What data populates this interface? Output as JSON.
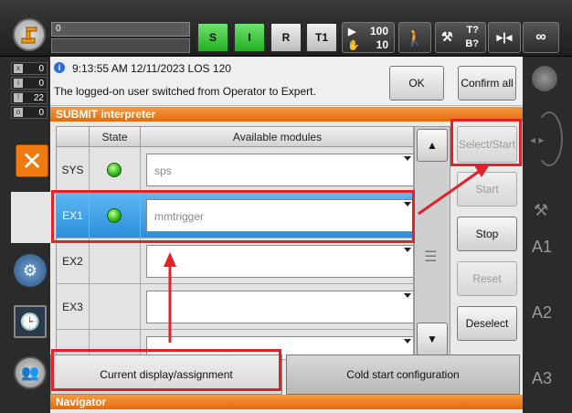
{
  "topbar": {
    "program_value": "0",
    "status_s": "S",
    "status_i": "I",
    "status_r": "R",
    "mode": "T1",
    "speed_top": "100",
    "speed_bottom": "10",
    "tool_top": "T?",
    "tool_bottom": "B?",
    "infinity": "∞"
  },
  "left_counters": [
    {
      "icon": "x",
      "value": "0"
    },
    {
      "icon": "i",
      "value": "0"
    },
    {
      "icon": "!",
      "value": "22"
    },
    {
      "icon": "o",
      "value": "0"
    }
  ],
  "message": {
    "info_icon": "i",
    "timestamp": "9:13:55 AM 12/11/2023 LOS 120",
    "text": "The logged-on user switched from Operator to Expert.",
    "ok_label": "OK",
    "confirm_all_label": "Confirm all"
  },
  "submit": {
    "header": "SUBMIT interpreter",
    "columns": [
      "State",
      "Available modules"
    ],
    "rows": [
      {
        "name": "SYS",
        "module": "sps",
        "running": true,
        "selected": false
      },
      {
        "name": "EX1",
        "module": "mmtrigger",
        "running": true,
        "selected": true
      },
      {
        "name": "EX2",
        "module": "",
        "running": false,
        "selected": false
      },
      {
        "name": "EX3",
        "module": "",
        "running": false,
        "selected": false
      }
    ]
  },
  "actions": {
    "select_start": "Select/Start",
    "start": "Start",
    "stop": "Stop",
    "reset": "Reset",
    "deselect": "Deselect"
  },
  "bottom_tabs": {
    "current": "Current display/assignment",
    "cold_start": "Cold start configuration"
  },
  "navigator": {
    "header": "Navigator"
  },
  "right_axes": [
    "A1",
    "A2",
    "A3"
  ],
  "colors": {
    "accent_orange": "#e26a0a",
    "selected_blue": "#2c8edc",
    "highlight_red": "#e0222a",
    "led_green": "#2fbf1a"
  }
}
